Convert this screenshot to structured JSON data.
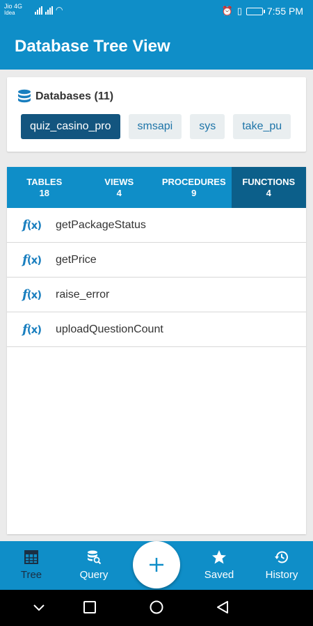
{
  "status_bar": {
    "carrier_line1": "Jio 4G",
    "carrier_line2": "Idea",
    "time": "7:55 PM"
  },
  "app_bar": {
    "title": "Database Tree View"
  },
  "databases": {
    "title": "Databases (11)",
    "chips": [
      {
        "label": "quiz_casino_pro",
        "selected": true
      },
      {
        "label": "smsapi"
      },
      {
        "label": "sys"
      },
      {
        "label": "take_pu"
      }
    ]
  },
  "tabs": [
    {
      "label": "TABLES",
      "count": "18"
    },
    {
      "label": "VIEWS",
      "count": "4"
    },
    {
      "label": "PROCEDURES",
      "count": "9"
    },
    {
      "label": "FUNCTIONS",
      "count": "4",
      "active": true
    }
  ],
  "functions": [
    {
      "name": "getPackageStatus",
      "icon": "function-icon"
    },
    {
      "name": "getPrice",
      "icon": "function-icon"
    },
    {
      "name": "raise_error",
      "icon": "function-icon"
    },
    {
      "name": "uploadQuestionCount",
      "icon": "function-icon"
    }
  ],
  "bottom_nav": {
    "items": [
      {
        "label": "Tree",
        "icon": "table-grid-icon",
        "active": true
      },
      {
        "label": "Query",
        "icon": "database-search-icon"
      },
      {
        "label": "Saved",
        "icon": "star-icon"
      },
      {
        "label": "History",
        "icon": "history-icon"
      }
    ],
    "fab_icon": "plus-icon"
  },
  "colors": {
    "primary": "#0f8ec8",
    "active_tab": "#0c5f8a",
    "chip_selected": "#13557f",
    "chip_default": "#e9eef0",
    "icon_blue": "#1a7fbf"
  }
}
